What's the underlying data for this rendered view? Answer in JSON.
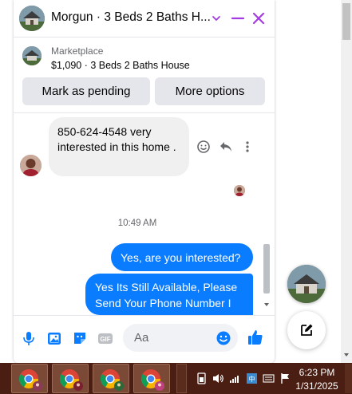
{
  "header": {
    "title": "Morgun · 3 Beds 2 Baths H...",
    "icons": [
      "house-avatar",
      "chevron-down-icon",
      "minimize-icon",
      "close-icon"
    ],
    "accent": "#a33be0"
  },
  "listing": {
    "label": "Marketplace",
    "title": "$1,090 · 3 Beds 2 Baths House"
  },
  "actions": {
    "pending_label": "Mark as pending",
    "more_label": "More options"
  },
  "messages": {
    "received_text": "850-624-4548 very interested in this home .",
    "timestamp": "10:49 AM",
    "sent": [
      "Yes, are you interested?",
      "Yes Its Still Available, Please Send Your Phone Number I"
    ],
    "bubble_color": "#0a7cff"
  },
  "composer": {
    "placeholder": "Aa",
    "icons": [
      "microphone-icon",
      "photo-icon",
      "sticker-icon",
      "gif-icon",
      "emoji-icon",
      "like-icon"
    ]
  },
  "taskbar": {
    "time": "6:23 PM",
    "date": "1/31/2025",
    "apps": [
      "chrome-profile-1",
      "chrome-profile-2",
      "chrome-profile-3",
      "chrome-profile-4"
    ]
  }
}
